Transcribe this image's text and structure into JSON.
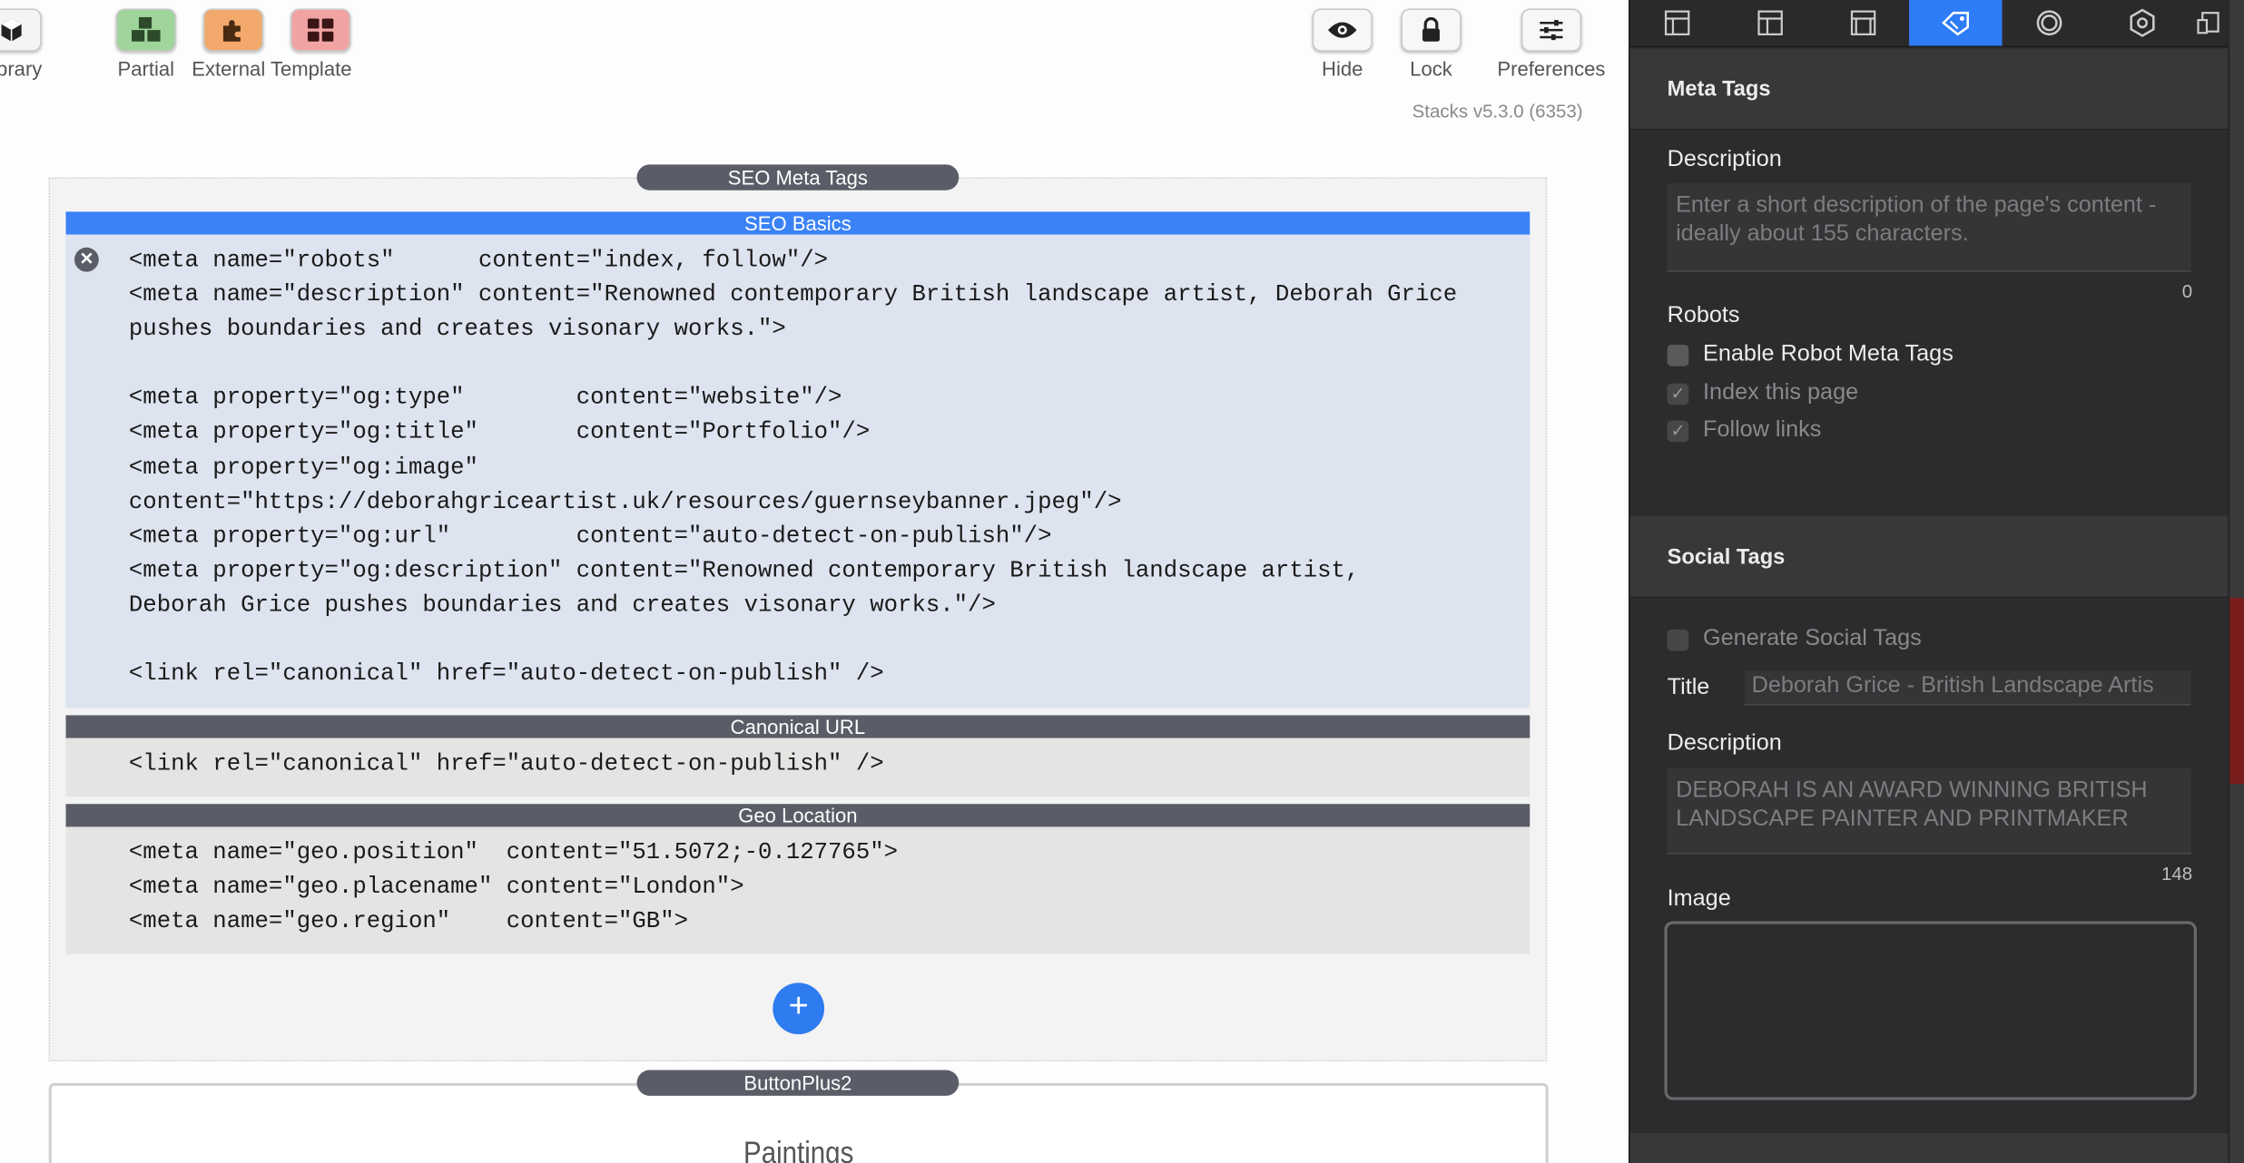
{
  "toolbar": {
    "library": "Library",
    "partial": "Partial",
    "external_template": "External Template",
    "hide": "Hide",
    "lock": "Lock",
    "preferences": "Preferences"
  },
  "version": "Stacks v5.3.0 (6353)",
  "editor": {
    "seo_meta_tags_title": "SEO Meta Tags",
    "seo_basics": {
      "title": "SEO Basics",
      "code": "<meta name=\"robots\"      content=\"index, follow\"/>\n<meta name=\"description\" content=\"Renowned contemporary British landscape artist, Deborah Grice\npushes boundaries and creates visonary works.\">\n\n<meta property=\"og:type\"        content=\"website\"/>\n<meta property=\"og:title\"       content=\"Portfolio\"/>\n<meta property=\"og:image\"\ncontent=\"https://deborahgriceartist.uk/resources/guernseybanner.jpeg\"/>\n<meta property=\"og:url\"         content=\"auto-detect-on-publish\"/>\n<meta property=\"og:description\" content=\"Renowned contemporary British landscape artist,\nDeborah Grice pushes boundaries and creates visonary works.\"/>\n\n<link rel=\"canonical\" href=\"auto-detect-on-publish\" />"
    },
    "canonical_url": {
      "title": "Canonical URL",
      "code": "<link rel=\"canonical\" href=\"auto-detect-on-publish\" />"
    },
    "geo_location": {
      "title": "Geo Location",
      "code": "<meta name=\"geo.position\"  content=\"51.5072;-0.127765\">\n<meta name=\"geo.placename\" content=\"London\">\n<meta name=\"geo.region\"    content=\"GB\">"
    },
    "buttonplus2_title": "ButtonPlus2",
    "paintings": "Paintings"
  },
  "inspector": {
    "meta_tags": {
      "header": "Meta Tags",
      "description_label": "Description",
      "description_placeholder": "Enter a short description of the page's content - ideally about 155 characters.",
      "description_count": "0",
      "robots_label": "Robots",
      "enable_robot_meta_tags": "Enable Robot Meta Tags",
      "index_this_page": "Index this page",
      "follow_links": "Follow links"
    },
    "social_tags": {
      "header": "Social Tags",
      "generate_social_tags": "Generate Social Tags",
      "title_label": "Title",
      "title_value": "Deborah Grice - British Landscape Artis",
      "description_label": "Description",
      "description_value": "DEBORAH IS AN AWARD WINNING BRITISH LANDSCAPE PAINTER AND PRINTMAKER",
      "description_count": "148",
      "image_label": "Image"
    }
  },
  "colors": {
    "accent": "#2e7cf6",
    "seo_basics_band": "#3b82f6",
    "section_band": "#5a5d67",
    "panel_bg": "#2c2c2e"
  }
}
